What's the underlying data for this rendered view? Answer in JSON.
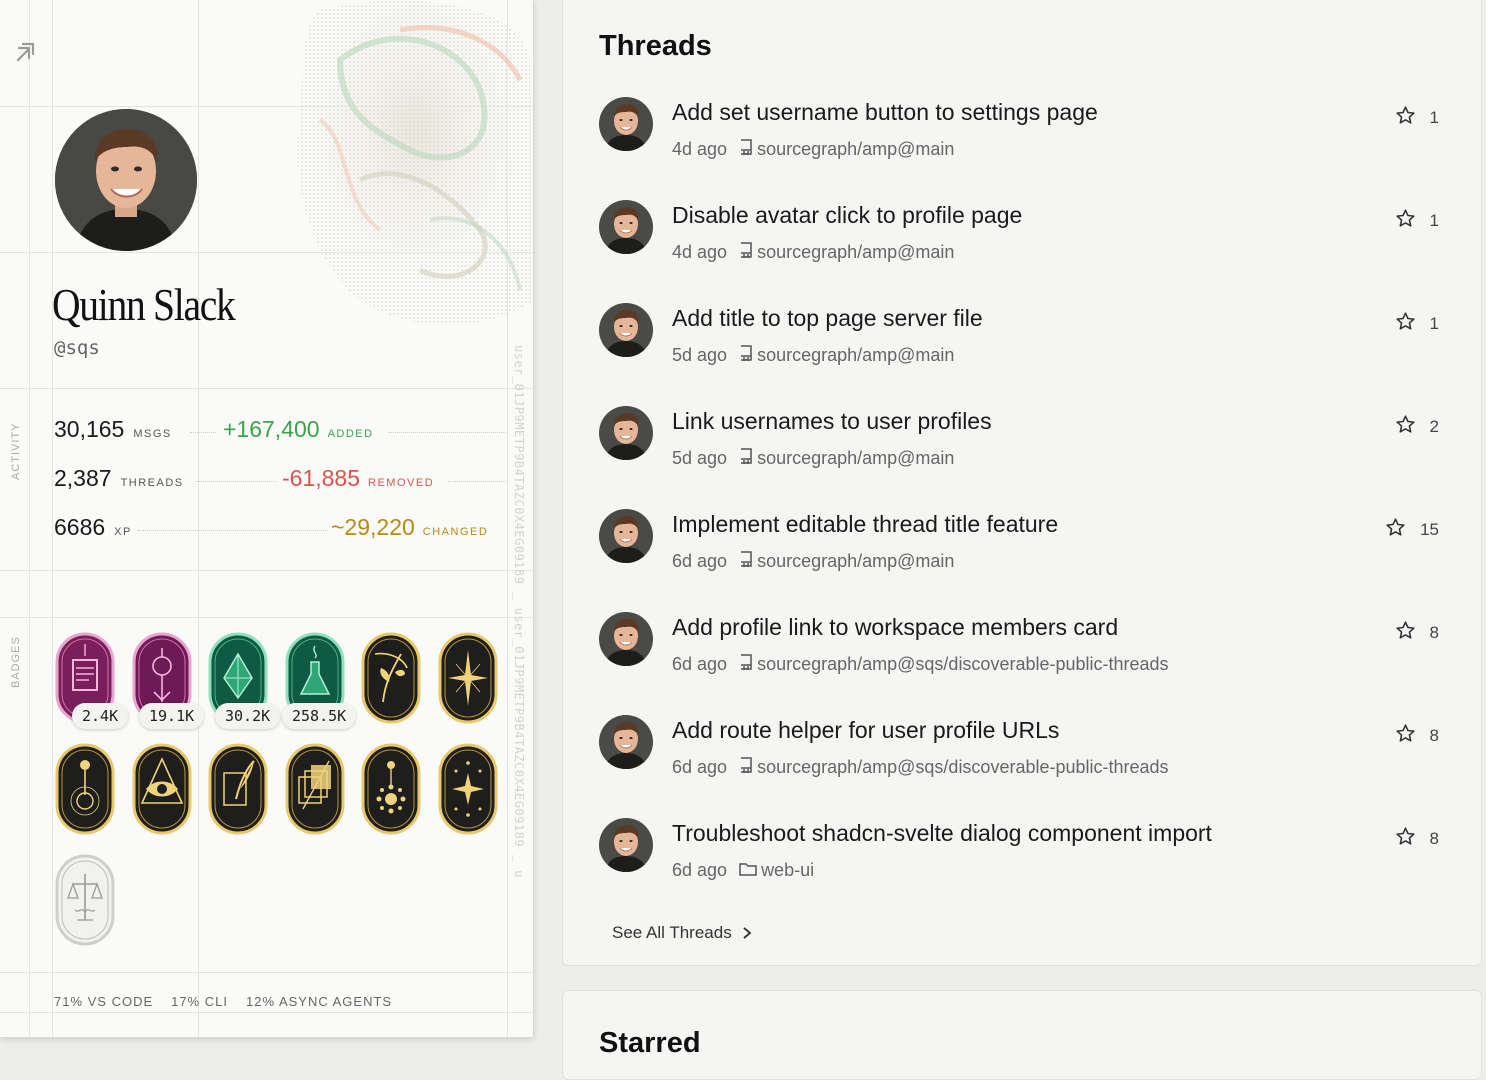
{
  "profile": {
    "name": "Quinn Slack",
    "handle": "@sqs",
    "user_id": "user_01JP9METP9B4TAZC0X4EG09189 _ user_01JP9METP9B4TAZC0X4EG09189 _ u",
    "section_labels": {
      "activity": "ACTIVITY",
      "badges": "BADGES"
    },
    "stats": [
      {
        "value": "30,165",
        "unit": "MSGS"
      },
      {
        "value": "2,387",
        "unit": "THREADS"
      },
      {
        "value": "6686",
        "unit": "XP"
      }
    ],
    "deltas": [
      {
        "value": "+167,400",
        "unit": "ADDED",
        "color": "#3aa34a"
      },
      {
        "value": "-61,885",
        "unit": "REMOVED",
        "color": "#d9534f"
      },
      {
        "value": "~29,220",
        "unit": "CHANGED",
        "color": "#b58a16"
      }
    ],
    "badges": [
      {
        "icon": "scroll-badge-icon",
        "theme": "magenta",
        "count": "2.4K"
      },
      {
        "icon": "hand-badge-icon",
        "theme": "magenta",
        "count": "19.1K"
      },
      {
        "icon": "diamond-badge-icon",
        "theme": "emerald",
        "count": "30.2K"
      },
      {
        "icon": "flask-badge-icon",
        "theme": "emerald",
        "count": "258.5K"
      },
      {
        "icon": "plant-badge-icon",
        "theme": "gold"
      },
      {
        "icon": "star-badge-icon",
        "theme": "gold"
      },
      {
        "icon": "pendulum-badge-icon",
        "theme": "gold"
      },
      {
        "icon": "eye-badge-icon",
        "theme": "gold"
      },
      {
        "icon": "quill-badge-icon",
        "theme": "gold"
      },
      {
        "icon": "layers-badge-icon",
        "theme": "gold"
      },
      {
        "icon": "sun-badge-icon",
        "theme": "gold"
      },
      {
        "icon": "moon-badge-icon",
        "theme": "gold"
      },
      {
        "icon": "scales-badge-icon",
        "theme": "silver"
      }
    ],
    "usage": [
      "71% VS CODE",
      "17% CLI",
      "12% ASYNC AGENTS"
    ]
  },
  "threads": {
    "title": "Threads",
    "items": [
      {
        "title": "Add set username button to settings page",
        "age": "4d ago",
        "location": "sourcegraph/amp@main",
        "location_type": "repo",
        "stars": "1"
      },
      {
        "title": "Disable avatar click to profile page",
        "age": "4d ago",
        "location": "sourcegraph/amp@main",
        "location_type": "repo",
        "stars": "1"
      },
      {
        "title": "Add title to top page server file",
        "age": "5d ago",
        "location": "sourcegraph/amp@main",
        "location_type": "repo",
        "stars": "1"
      },
      {
        "title": "Link usernames to user profiles",
        "age": "5d ago",
        "location": "sourcegraph/amp@main",
        "location_type": "repo",
        "stars": "2"
      },
      {
        "title": "Implement editable thread title feature",
        "age": "6d ago",
        "location": "sourcegraph/amp@main",
        "location_type": "repo",
        "stars": "15"
      },
      {
        "title": "Add profile link to workspace members card",
        "age": "6d ago",
        "location": "sourcegraph/amp@sqs/discoverable-public-threads",
        "location_type": "repo",
        "stars": "8"
      },
      {
        "title": "Add route helper for user profile URLs",
        "age": "6d ago",
        "location": "sourcegraph/amp@sqs/discoverable-public-threads",
        "location_type": "repo",
        "stars": "8"
      },
      {
        "title": "Troubleshoot shadcn-svelte dialog component import",
        "age": "6d ago",
        "location": "web-ui",
        "location_type": "folder",
        "stars": "8"
      }
    ],
    "see_all_label": "See All Threads"
  },
  "starred": {
    "title": "Starred"
  },
  "colors": {
    "added": "#3aa34a",
    "removed": "#d9534f",
    "changed": "#b58a16"
  }
}
